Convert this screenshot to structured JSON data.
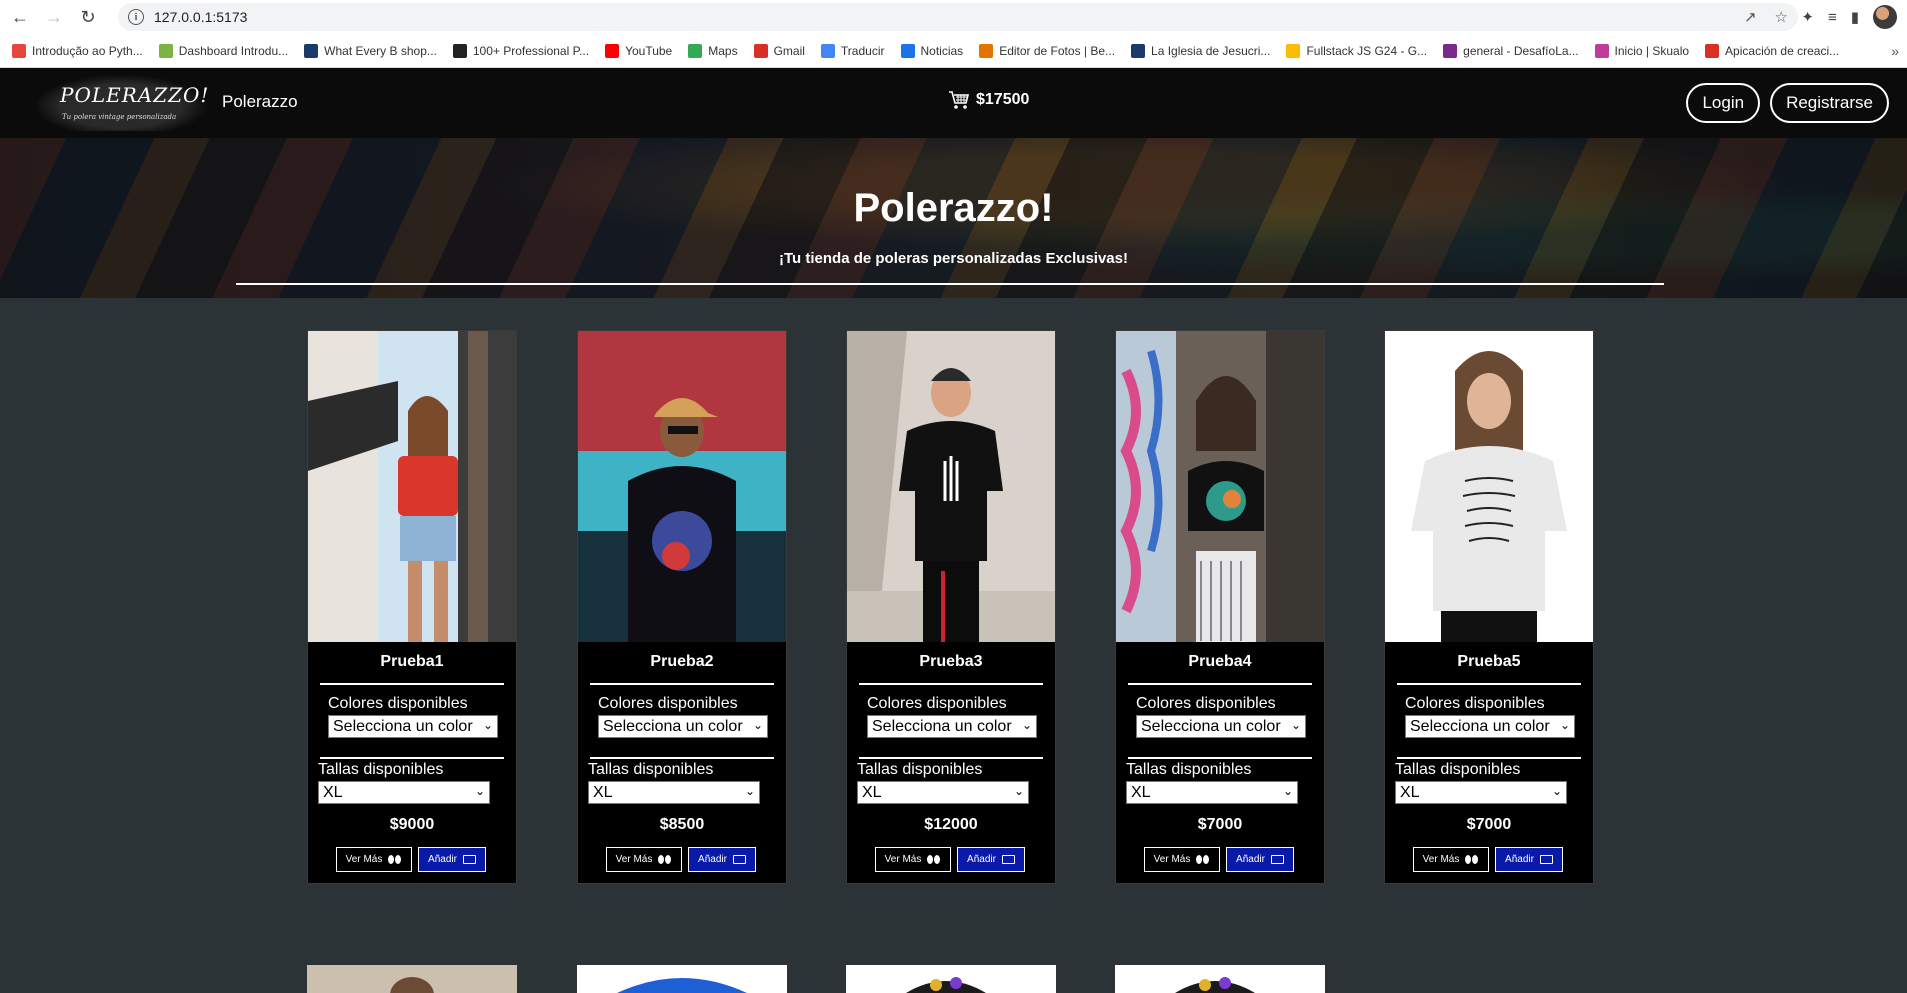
{
  "browser": {
    "url": "127.0.0.1:5173",
    "bookmarks": [
      {
        "label": "Introdução ao Pyth...",
        "color": "#e8453c"
      },
      {
        "label": "Dashboard Introdu...",
        "color": "#7cb342"
      },
      {
        "label": "What Every B shop...",
        "color": "#1a3a6b"
      },
      {
        "label": "100+ Professional P...",
        "color": "#222222"
      },
      {
        "label": "YouTube",
        "color": "#ff0000"
      },
      {
        "label": "Maps",
        "color": "#34a853"
      },
      {
        "label": "Gmail",
        "color": "#d93025"
      },
      {
        "label": "Traducir",
        "color": "#4285f4"
      },
      {
        "label": "Noticias",
        "color": "#1a73e8"
      },
      {
        "label": "Editor de Fotos | Be...",
        "color": "#e37400"
      },
      {
        "label": "La Iglesia de Jesucri...",
        "color": "#1a3a6b"
      },
      {
        "label": "Fullstack JS G24 - G...",
        "color": "#fbbc04"
      },
      {
        "label": "general - DesafíoLa...",
        "color": "#7b2a8c"
      },
      {
        "label": "Inicio | Skualo",
        "color": "#c13b9a"
      },
      {
        "label": "Apicación de creaci...",
        "color": "#d93025"
      }
    ]
  },
  "navbar": {
    "logo_text": "POLERAZZO!",
    "logo_tagline": "Tu polera vintage personalizada",
    "brand": "Polerazzo",
    "cart_total": "$17500",
    "login_label": "Login",
    "register_label": "Registrarse"
  },
  "hero": {
    "title": "Polerazzo!",
    "subtitle": "¡Tu tienda de poleras personalizadas Exclusivas!"
  },
  "product_labels": {
    "colors_label": "Colores disponibles",
    "color_placeholder": "Selecciona un color",
    "sizes_label": "Tallas disponibles",
    "more_label": "Ver Más",
    "add_label": "Añadir"
  },
  "products": [
    {
      "name": "Prueba1",
      "price": "$9000",
      "size": "XL"
    },
    {
      "name": "Prueba2",
      "price": "$8500",
      "size": "XL"
    },
    {
      "name": "Prueba3",
      "price": "$12000",
      "size": "XL"
    },
    {
      "name": "Prueba4",
      "price": "$7000",
      "size": "XL"
    },
    {
      "name": "Prueba5",
      "price": "$7000",
      "size": "XL"
    }
  ],
  "colors": {
    "navbar_bg": "#0b0b0b",
    "page_bg": "#2b3336",
    "add_button": "#0a1aa8"
  }
}
